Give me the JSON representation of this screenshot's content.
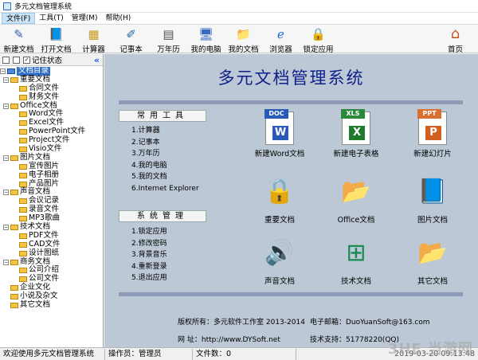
{
  "window": {
    "title": "多元文档管理系统"
  },
  "menu": [
    "文件(F)",
    "工具(T)",
    "管理(M)",
    "帮助(H)"
  ],
  "toolbar": {
    "items": [
      {
        "label": "新建文档",
        "icon": "pen-icon",
        "glyph": "✎",
        "color": "#3060b0"
      },
      {
        "label": "打开文档",
        "icon": "book-icon",
        "glyph": "📘",
        "color": "#2050c0"
      },
      {
        "label": "计算器",
        "icon": "calculator-icon",
        "glyph": "▦",
        "color": "#c89a20"
      },
      {
        "label": "记事本",
        "icon": "notepad-icon",
        "glyph": "✐",
        "color": "#2060a0"
      },
      {
        "label": "万年历",
        "icon": "calendar-icon",
        "glyph": "▤",
        "color": "#505050"
      },
      {
        "label": "我的电脑",
        "icon": "computer-icon",
        "glyph": "🖥",
        "color": "#3a6ac0"
      },
      {
        "label": "我的文档",
        "icon": "folder-icon",
        "glyph": "📁",
        "color": "#d8a020"
      },
      {
        "label": "浏览器",
        "icon": "ie-icon",
        "glyph": "ℯ",
        "color": "#1a6ad8"
      },
      {
        "label": "锁定应用",
        "icon": "lock-icon",
        "glyph": "🔒",
        "color": "#d07a20"
      }
    ],
    "home": {
      "label": "首页",
      "icon": "home-icon",
      "glyph": "⌂",
      "color": "#c8501a"
    }
  },
  "sidebar": {
    "tab_label": "记住状态",
    "tree": [
      {
        "label": "文档目录",
        "level": 0,
        "type": "root"
      },
      {
        "label": "重要文档",
        "level": 1,
        "type": "folder"
      },
      {
        "label": "合同文件",
        "level": 2,
        "type": "folder"
      },
      {
        "label": "财务文件",
        "level": 2,
        "type": "folder"
      },
      {
        "label": "Office文档",
        "level": 1,
        "type": "folder"
      },
      {
        "label": "Word文件",
        "level": 2,
        "type": "folder"
      },
      {
        "label": "Excel文件",
        "level": 2,
        "type": "folder"
      },
      {
        "label": "PowerPoint文件",
        "level": 2,
        "type": "folder"
      },
      {
        "label": "Project文件",
        "level": 2,
        "type": "folder"
      },
      {
        "label": "Visio文件",
        "level": 2,
        "type": "folder"
      },
      {
        "label": "图片文档",
        "level": 1,
        "type": "folder"
      },
      {
        "label": "宣传图片",
        "level": 2,
        "type": "folder"
      },
      {
        "label": "电子相册",
        "level": 2,
        "type": "folder"
      },
      {
        "label": "产品图片",
        "level": 2,
        "type": "folder"
      },
      {
        "label": "声音文档",
        "level": 1,
        "type": "folder"
      },
      {
        "label": "会议记录",
        "level": 2,
        "type": "folder"
      },
      {
        "label": "录音文件",
        "level": 2,
        "type": "folder"
      },
      {
        "label": "MP3歌曲",
        "level": 2,
        "type": "folder"
      },
      {
        "label": "技术文档",
        "level": 1,
        "type": "folder"
      },
      {
        "label": "PDF文件",
        "level": 2,
        "type": "folder"
      },
      {
        "label": "CAD文件",
        "level": 2,
        "type": "folder"
      },
      {
        "label": "设计图纸",
        "level": 2,
        "type": "folder"
      },
      {
        "label": "商务文档",
        "level": 1,
        "type": "folder"
      },
      {
        "label": "公司介绍",
        "level": 2,
        "type": "folder"
      },
      {
        "label": "公司文件",
        "level": 2,
        "type": "folder"
      },
      {
        "label": "企业文化",
        "level": 1,
        "type": "leaf"
      },
      {
        "label": "小说及杂文",
        "level": 1,
        "type": "leaf"
      },
      {
        "label": "其它文档",
        "level": 1,
        "type": "leaf"
      }
    ]
  },
  "main": {
    "title": "多元文档管理系统",
    "tools_title": "常用工具",
    "tools": [
      "1.计算器",
      "2.记事本",
      "3.万年历",
      "4.我的电脑",
      "5.我的文档",
      "6.Internet Explorer"
    ],
    "admin_title": "系统管理",
    "admin": [
      "1.锁定应用",
      "2.修改密码",
      "3.背景音乐",
      "4.重新登录",
      "5.退出应用"
    ],
    "grid": [
      {
        "label": "新建Word文档",
        "kind": "file",
        "tag": "DOC",
        "tag_color": "#2a5ab8",
        "glyph": "W",
        "glyph_color": "#2a5ab8"
      },
      {
        "label": "新建电子表格",
        "kind": "file",
        "tag": "XLS",
        "tag_color": "#2a8a3a",
        "glyph": "X",
        "glyph_color": "#1f7a2e"
      },
      {
        "label": "新建幻灯片",
        "kind": "file",
        "tag": "PPT",
        "tag_color": "#d87030",
        "glyph": "P",
        "glyph_color": "#d06020"
      },
      {
        "label": "重要文档",
        "kind": "icon",
        "icon": "padlock-icon",
        "glyph": "🔒",
        "color": "#808890"
      },
      {
        "label": "Office文档",
        "kind": "icon",
        "icon": "office-folder-icon",
        "glyph": "📂",
        "color": "#2a60c0"
      },
      {
        "label": "图片文档",
        "kind": "icon",
        "icon": "image-book-icon",
        "glyph": "📘",
        "color": "#1a40b0"
      },
      {
        "label": "声音文档",
        "kind": "icon",
        "icon": "speaker-icon",
        "glyph": "🔊",
        "color": "#404040"
      },
      {
        "label": "技术文档",
        "kind": "icon",
        "icon": "network-icon",
        "glyph": "⊞",
        "color": "#1a8a50"
      },
      {
        "label": "其它文档",
        "kind": "icon",
        "icon": "open-folder-icon",
        "glyph": "📂",
        "color": "#d8a020"
      }
    ],
    "footer": {
      "copyright": "版权所有：多元软件工作室 2013-2014",
      "email": "电子邮箱：DuoYuanSoft@163.com",
      "website": "网    址：http://www.DYSoft.net",
      "support": "技术支持：51778220(QQ)"
    }
  },
  "status": {
    "welcome": "欢迎使用多元文档管理系统",
    "operator": "操作员：管理员",
    "file_count": "文件数：0",
    "datetime": "2019-03-20 09:13:48"
  },
  "watermark": "3HE 当游网"
}
